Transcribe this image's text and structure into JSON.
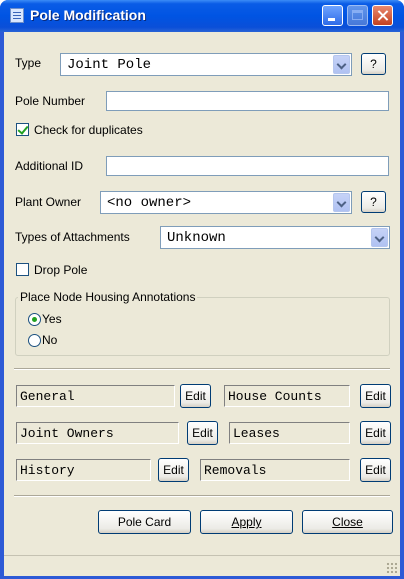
{
  "window": {
    "title": "Pole Modification",
    "icon": "app-document-icon"
  },
  "type": {
    "label": "Type",
    "value": "Joint Pole",
    "help": "?"
  },
  "pole_number": {
    "label": "Pole Number",
    "value": ""
  },
  "check_duplicates": {
    "label": "Check for duplicates",
    "checked": true
  },
  "additional_id": {
    "label": "Additional ID",
    "value": ""
  },
  "plant_owner": {
    "label": "Plant Owner",
    "value": "<no owner>",
    "help": "?"
  },
  "attachments": {
    "label": "Types of Attachments",
    "value": "Unknown"
  },
  "drop_pole": {
    "label": "Drop Pole",
    "checked": false
  },
  "node_housing": {
    "title": "Place Node Housing Annotations",
    "options": [
      {
        "label": "Yes",
        "selected": true
      },
      {
        "label": "No",
        "selected": false
      }
    ]
  },
  "sections": {
    "general": "General",
    "house_counts": "House Counts",
    "joint_owners": "Joint Owners",
    "leases": "Leases",
    "history": "History",
    "removals": "Removals",
    "edit": "Edit"
  },
  "footer": {
    "pole_card": "Pole Card",
    "apply": "Apply",
    "close": "Close"
  }
}
